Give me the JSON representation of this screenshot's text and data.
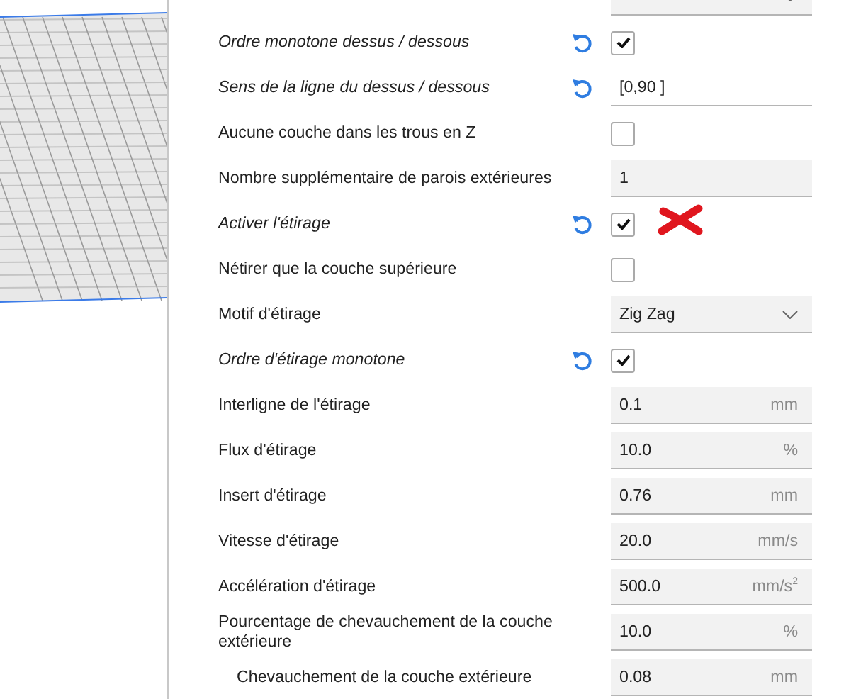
{
  "settings": [
    {
      "kind": "dropdown"
    },
    {
      "label": "Ordre monotone dessus / dessous",
      "modified": true,
      "kind": "checkbox",
      "checked": true
    },
    {
      "label": "Sens de la ligne du dessus / dessous",
      "modified": true,
      "kind": "text",
      "value": "[0,90 ]"
    },
    {
      "label": "Aucune couche dans les trous en Z",
      "modified": false,
      "kind": "checkbox",
      "checked": false
    },
    {
      "label": "Nombre supplémentaire de parois extérieures",
      "modified": false,
      "kind": "number",
      "value": "1"
    },
    {
      "label": "Activer l'étirage",
      "modified": true,
      "kind": "checkbox",
      "checked": true,
      "marked": true
    },
    {
      "label": "Nétirer que la couche supérieure",
      "modified": false,
      "kind": "checkbox",
      "checked": false
    },
    {
      "label": "Motif d'étirage",
      "modified": false,
      "kind": "dropdown",
      "value": "Zig Zag"
    },
    {
      "label": "Ordre d'étirage monotone",
      "modified": true,
      "kind": "checkbox",
      "checked": true
    },
    {
      "label": "Interligne de l'étirage",
      "modified": false,
      "kind": "number",
      "value": "0.1",
      "unit": "mm"
    },
    {
      "label": "Flux d'étirage",
      "modified": false,
      "kind": "number",
      "value": "10.0",
      "unit": "%"
    },
    {
      "label": "Insert d'étirage",
      "modified": false,
      "kind": "number",
      "value": "0.76",
      "unit": "mm"
    },
    {
      "label": "Vitesse d'étirage",
      "modified": false,
      "kind": "number",
      "value": "20.0",
      "unit": "mm/s"
    },
    {
      "label": "Accélération d'étirage",
      "modified": false,
      "kind": "number",
      "value": "500.0",
      "unit": "mm/s$^{2}$"
    },
    {
      "label": "Pourcentage de chevauchement de la couche extérieure",
      "modified": false,
      "kind": "number",
      "value": "10.0",
      "unit": "%",
      "children": [
        {
          "label": "Chevauchement de la couche extérieure",
          "modified": false,
          "kind": "number",
          "value": "0.08",
          "unit": "mm"
        }
      ]
    }
  ]
}
